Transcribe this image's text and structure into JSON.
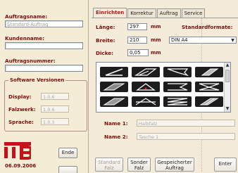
{
  "left": {
    "auftragsname_label": "Auftragsname:",
    "auftragsname_value": "Standard-Auftrag",
    "kundenname_label": "Kundenname:",
    "kundenname_value": "",
    "auftragsnummer_label": "Auftragsnummer:",
    "auftragsnummer_value": "",
    "software_title": "Software Versionen",
    "display_label": "Display:",
    "display_value": "1.0.6",
    "falzwerk_label": "Falzwerk:",
    "falzwerk_value": "1.0.6",
    "sprache_label": "Sprache:",
    "sprache_value": "1.0.3",
    "ende_label": "Ende",
    "date": "06.09.2006"
  },
  "tabs": [
    "Einrichten",
    "Korrektur",
    "Auftrag",
    "Service"
  ],
  "form": {
    "laenge_label": "Länge:",
    "laenge_value": "297",
    "breite_label": "Breite:",
    "breite_value": "210",
    "dicke_label": "Dicke:",
    "dicke_value": "0,05",
    "unit": "mm",
    "standardformate_label": "Standardformate:",
    "standardformate_value": "DIN A4"
  },
  "names": {
    "name1_label": "Name 1:",
    "name1_value": "Halbfalz",
    "name2_label": "Name 2:",
    "name2_value": "Tasche 1"
  },
  "buttons": {
    "standard_falz": "Standard\nFalz",
    "sonder_falz": "Sonder\nFalz",
    "gespeicherter_auftrag": "Gespeicherter\nAuftrag",
    "enter": "Enter"
  },
  "colors": {
    "label": "#7a0c0c",
    "active_tab": "#b31818",
    "tile_bg": "#1d1d1d"
  },
  "fold_icons": [
    "fold-1",
    "fold-2",
    "fold-3",
    "fold-4",
    "fold-5",
    "fold-6",
    "fold-7",
    "fold-8",
    "fold-9",
    "fold-10",
    "fold-11",
    "fold-12"
  ]
}
